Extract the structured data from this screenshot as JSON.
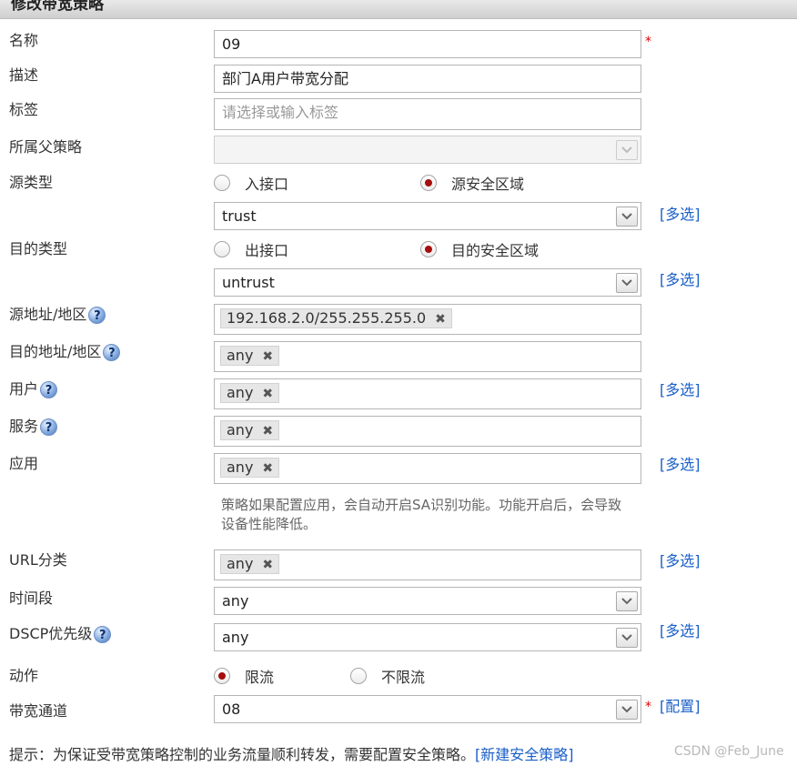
{
  "dialog": {
    "title": "修改带宽策略"
  },
  "form": {
    "name": {
      "label": "名称",
      "value": "09",
      "required": "*"
    },
    "description": {
      "label": "描述",
      "value": "部门A用户带宽分配"
    },
    "tags": {
      "label": "标签",
      "placeholder": "请选择或输入标签"
    },
    "parent_policy": {
      "label": "所属父策略",
      "value": ""
    },
    "source_type": {
      "label": "源类型",
      "option1": "入接口",
      "option2": "源安全区域",
      "selected": "源安全区域",
      "zone": "trust",
      "multi": "[多选]"
    },
    "dest_type": {
      "label": "目的类型",
      "option1": "出接口",
      "option2": "目的安全区域",
      "selected": "目的安全区域",
      "zone": "untrust",
      "multi": "[多选]"
    },
    "source_address": {
      "label": "源地址/地区",
      "tag": "192.168.2.0/255.255.255.0"
    },
    "dest_address": {
      "label": "目的地址/地区",
      "tag": "any"
    },
    "user": {
      "label": "用户",
      "tag": "any",
      "multi": "[多选]"
    },
    "service": {
      "label": "服务",
      "tag": "any"
    },
    "application": {
      "label": "应用",
      "tag": "any",
      "multi": "[多选]",
      "note": "策略如果配置应用，会自动开启SA识别功能。功能开启后，会导致设备性能降低。"
    },
    "url_category": {
      "label": "URL分类",
      "tag": "any",
      "multi": "[多选]"
    },
    "time_range": {
      "label": "时间段",
      "value": "any"
    },
    "dscp": {
      "label": "DSCP优先级",
      "value": "any",
      "multi": "[多选]"
    },
    "action": {
      "label": "动作",
      "option1": "限流",
      "option2": "不限流",
      "selected": "限流"
    },
    "bandwidth_channel": {
      "label": "带宽通道",
      "value": "08",
      "required": "*",
      "config": "[配置]"
    }
  },
  "help_glyph": "?",
  "remove_glyph": "✖",
  "tip": {
    "text": "提示：为保证受带宽策略控制的业务流量顺利转发，需要配置安全策略。",
    "link": "[新建安全策略]"
  },
  "watermark": "CSDN @Feb_June",
  "colors": {
    "link": "#1a5fc8",
    "radio_selected": "#a50c0c",
    "required": "#dd0000"
  }
}
